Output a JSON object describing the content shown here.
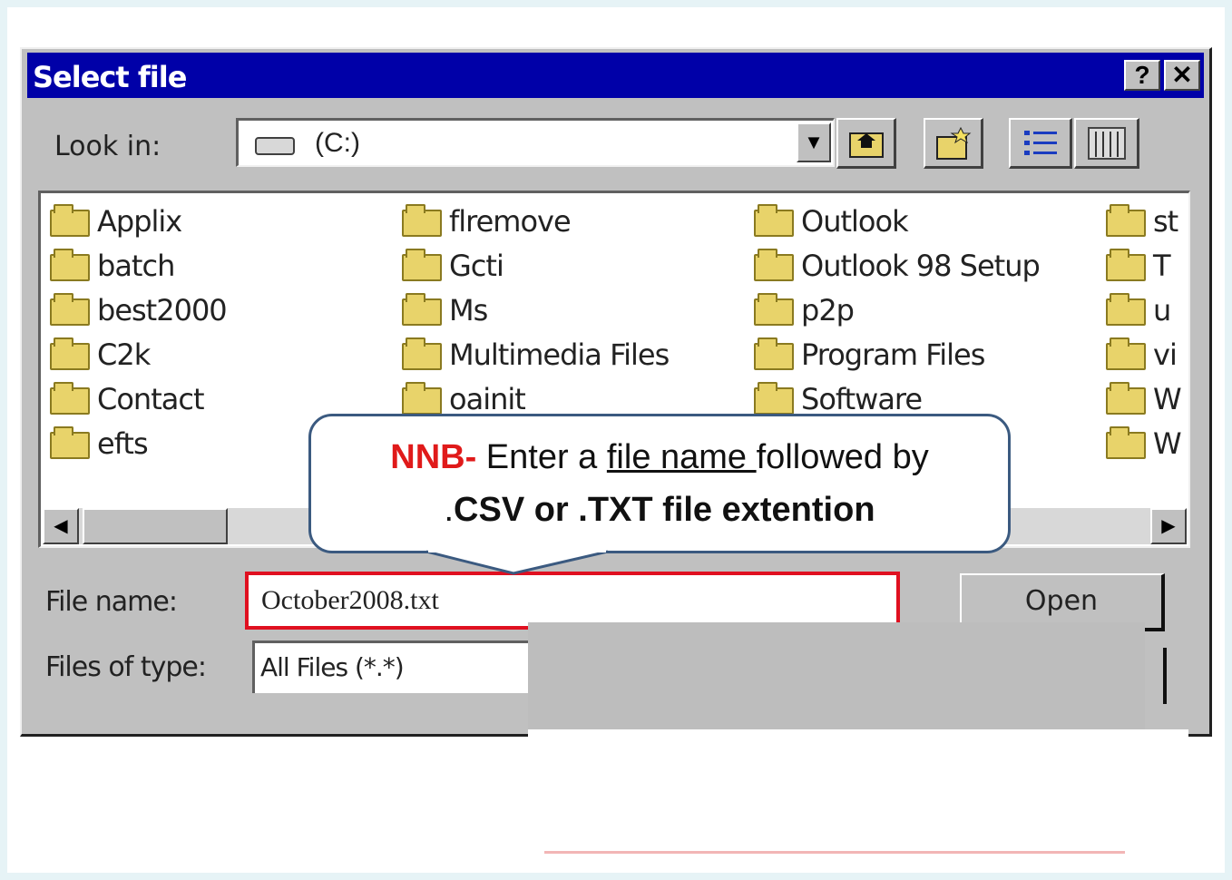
{
  "dialog": {
    "title": "Select file",
    "help_button": "?",
    "close_button": "✕"
  },
  "look_in": {
    "label": "Look in:",
    "value": "(C:)"
  },
  "toolbar": {
    "up_icon": "up-folder-icon",
    "new_folder_icon": "new-folder-icon",
    "list_view_icon": "list-view-icon",
    "details_view_icon": "details-view-icon"
  },
  "folders": {
    "col1": [
      "Applix",
      "batch",
      "best2000",
      "C2k",
      "Contact",
      "efts"
    ],
    "col2": [
      "flremove",
      "Gcti",
      "Ms",
      "Multimedia Files",
      "oainit"
    ],
    "col3": [
      "Outlook",
      "Outlook 98 Setup",
      "p2p",
      "Program Files",
      "Software"
    ],
    "col4": [
      "st",
      "T",
      "u",
      "vi",
      "W",
      "W"
    ]
  },
  "file_name": {
    "label": "File name:",
    "value": "October2008.txt"
  },
  "files_of_type": {
    "label": "Files of type:",
    "value": "All Files (*.*)"
  },
  "buttons": {
    "open": "Open"
  },
  "callout": {
    "prefix": "NNB-",
    "text1": " Enter a ",
    "underlined": "file name ",
    "text2": "followed by",
    "line2_dot": ".",
    "line2_bold": "CSV or .TXT file extention"
  },
  "colors": {
    "titlebar": "#0000a8",
    "dialog_face": "#c0c0c0",
    "highlight_red": "#e01020",
    "callout_border": "#3b5a80",
    "nnb_red": "#e01a1a"
  }
}
